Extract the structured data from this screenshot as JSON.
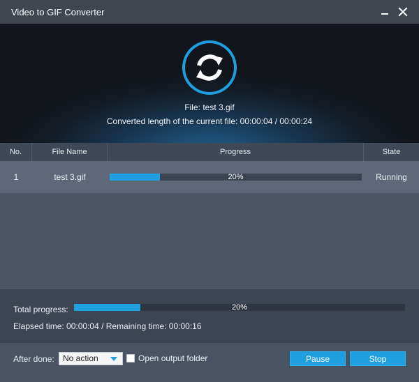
{
  "window": {
    "title": "Video to GIF Converter",
    "icons": {
      "minimize": "minimize-icon",
      "close": "close-icon",
      "hero": "convert-refresh-icon"
    }
  },
  "hero": {
    "file_text": "File: test 3.gif",
    "length_text": "Converted length of the current file: 00:00:04 / 00:00:24"
  },
  "table": {
    "columns": [
      "No.",
      "File Name",
      "Progress",
      "State"
    ],
    "rows": [
      {
        "no": "1",
        "file_name": "test 3.gif",
        "progress": 0.2,
        "progress_label": "20%",
        "state": "Running"
      }
    ]
  },
  "summary": {
    "total_label": "Total progress:",
    "total_progress": 0.2,
    "total_progress_label": "20%",
    "time_text": "Elapsed time: 00:00:04 / Remaining time: 00:00:16"
  },
  "footer": {
    "after_done_label": "After done:",
    "after_done_value": "No action",
    "open_folder_label": "Open output folder",
    "open_folder_checked": false,
    "pause_label": "Pause",
    "stop_label": "Stop"
  },
  "colors": {
    "accent": "#1e9fe0",
    "titlebar": "#3f4650",
    "hero_glow": "#1f5f8f"
  }
}
